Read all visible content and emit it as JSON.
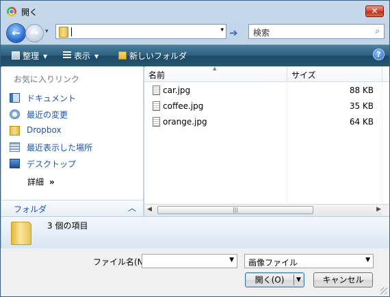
{
  "window": {
    "title": "開く",
    "close_label": "✕"
  },
  "nav": {
    "back_label": "←",
    "forward_label": "→",
    "history_label": "▾",
    "address_value": "",
    "address_dropdown": "▾",
    "go_label": "➔",
    "search_placeholder": "検索",
    "search_icon": "search-icon"
  },
  "toolbar": {
    "organize_label": "整理",
    "views_label": "表示",
    "new_folder_label": "新しいフォルダ",
    "help_label": "?",
    "dropdown_arrow": "▼",
    "colors": {
      "bar": "#2d5f7e"
    }
  },
  "sidebar": {
    "favorites_header": "お気に入りリンク",
    "items": [
      {
        "label": "ドキュメント",
        "icon": "documents-icon"
      },
      {
        "label": "最近の変更",
        "icon": "recent-changes-icon"
      },
      {
        "label": "Dropbox",
        "icon": "folder-icon"
      },
      {
        "label": "最近表示した場所",
        "icon": "recent-places-icon"
      },
      {
        "label": "デスクトップ",
        "icon": "desktop-icon"
      }
    ],
    "more_label": "詳細",
    "more_chevron": "»",
    "folders_label": "フォルダ",
    "folders_collapse": "︿"
  },
  "files": {
    "columns": {
      "name": "名前",
      "size": "サイズ"
    },
    "sort_indicator": "▲",
    "rows": [
      {
        "name": "car.jpg",
        "size": "88 KB"
      },
      {
        "name": "coffee.jpg",
        "size": "35 KB"
      },
      {
        "name": "orange.jpg",
        "size": "64 KB"
      }
    ],
    "scroll": {
      "left": "◀",
      "right": "▶",
      "thumb_grip": "|||"
    }
  },
  "details": {
    "text": "3 個の項目"
  },
  "footer": {
    "filename_label": "ファイル名(N):",
    "filename_value": "",
    "filename_dropdown": "▼",
    "filter_value": "画像ファイル",
    "filter_dropdown": "▼",
    "open_label": "開く(O)",
    "open_split_arrow": "▼",
    "cancel_label": "キャンセル"
  }
}
